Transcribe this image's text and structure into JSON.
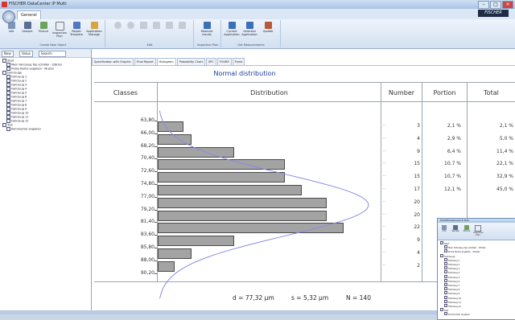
{
  "window": {
    "title": "FISCHER DataCenter IP Multi",
    "brand": "FISCHER",
    "active_tab": "General"
  },
  "ribbon": {
    "groups": [
      {
        "label": "Create New Object",
        "buttons": [
          "Info",
          "Sample",
          "Picture",
          "Inspection Plan",
          "Report Template",
          "Application Manage"
        ]
      },
      {
        "label": "Edit",
        "buttons": [
          "",
          "",
          "",
          "",
          "",
          ""
        ]
      },
      {
        "label": "Inspection Plan",
        "buttons": [
          "Measure results"
        ]
      },
      {
        "label": "Get Measurements",
        "buttons": [
          "Current Application",
          "Selected Application",
          "Update"
        ]
      }
    ]
  },
  "left_panel": {
    "toolbar": [
      "New",
      "Value",
      "Search"
    ],
    "tree": [
      {
        "label": "Start",
        "indent": 0
      },
      {
        "label": "Mein Fahrzeug Typ schläfer - DDUGI",
        "indent": 1
      },
      {
        "label": "Probe Name angeben - Muster",
        "indent": 1
      },
      {
        "label": "Fahrzeuge",
        "indent": 0
      },
      {
        "label": "Fahrzeug 1",
        "indent": 1
      },
      {
        "label": "Fahrzeug 2",
        "indent": 1
      },
      {
        "label": "Fahrzeug 3",
        "indent": 1
      },
      {
        "label": "Fahrzeug 4",
        "indent": 1
      },
      {
        "label": "Fahrzeug 5",
        "indent": 1
      },
      {
        "label": "Fahrzeug 6",
        "indent": 1
      },
      {
        "label": "Fahrzeug 7",
        "indent": 1
      },
      {
        "label": "Fahrzeug 8",
        "indent": 1
      },
      {
        "label": "Fahrzeug 9",
        "indent": 1
      },
      {
        "label": "Fahrzeug 10",
        "indent": 1
      },
      {
        "label": "Fahrzeug 11",
        "indent": 1
      },
      {
        "label": "Fahrzeug 12",
        "indent": 1
      },
      {
        "label": "Test",
        "indent": 0
      },
      {
        "label": "Kommentar angeben",
        "indent": 1
      }
    ]
  },
  "view_tabs": [
    "Specification with Graphic",
    "Final Report",
    "Histogram",
    "Probability Chart",
    "SPC",
    "FOURE",
    "Trend"
  ],
  "view_tab_active": 2,
  "table": {
    "title": "Normal distribution",
    "headers": {
      "classes": "Classes",
      "distribution": "Distribution",
      "number": "Number",
      "portion": "Portion",
      "total": "Total"
    },
    "rows": [
      {
        "cls": "63,80",
        "number": "3",
        "portion": "2,1 %",
        "total": "2,1 %"
      },
      {
        "cls": "66,00",
        "number": "4",
        "portion": "2,9 %",
        "total": "5,0 %"
      },
      {
        "cls": "68,20",
        "number": "9",
        "portion": "6,4 %",
        "total": "11,4 %"
      },
      {
        "cls": "70,40",
        "number": "15",
        "portion": "10,7 %",
        "total": "22,1 %"
      },
      {
        "cls": "72,60",
        "number": "15",
        "portion": "10,7 %",
        "total": "32,9 %"
      },
      {
        "cls": "74,80",
        "number": "17",
        "portion": "12,1 %",
        "total": "45,0 %"
      },
      {
        "cls": "77,00",
        "number": "20",
        "portion": "",
        "total": ""
      },
      {
        "cls": "79,20",
        "number": "20",
        "portion": "",
        "total": ""
      },
      {
        "cls": "81,40",
        "number": "22",
        "portion": "",
        "total": ""
      },
      {
        "cls": "83,60",
        "number": "9",
        "portion": "",
        "total": ""
      },
      {
        "cls": "85,80",
        "number": "4",
        "portion": "",
        "total": ""
      },
      {
        "cls": "88,00",
        "number": "2",
        "portion": "",
        "total": ""
      },
      {
        "cls": "90,20",
        "number": "",
        "portion": "",
        "total": ""
      }
    ],
    "stats": {
      "mean": "d = 77,32 µm",
      "stddev": "s = 5,32 µm",
      "count": "N = 140"
    }
  },
  "chart_data": {
    "type": "bar",
    "orientation": "horizontal",
    "categories": [
      "63,80",
      "66,00",
      "68,20",
      "70,40",
      "72,60",
      "74,80",
      "77,00",
      "79,20",
      "81,40",
      "83,60",
      "85,80",
      "88,00",
      "90,20"
    ],
    "values": [
      3,
      4,
      9,
      15,
      15,
      17,
      20,
      20,
      22,
      9,
      4,
      2,
      0
    ],
    "overlay": "normal distribution curve",
    "title": "Normal distribution"
  },
  "colors": {
    "bar_fill": "#a3a3a3",
    "curve": "#8a8ae6",
    "title": "#1f3c9c"
  }
}
